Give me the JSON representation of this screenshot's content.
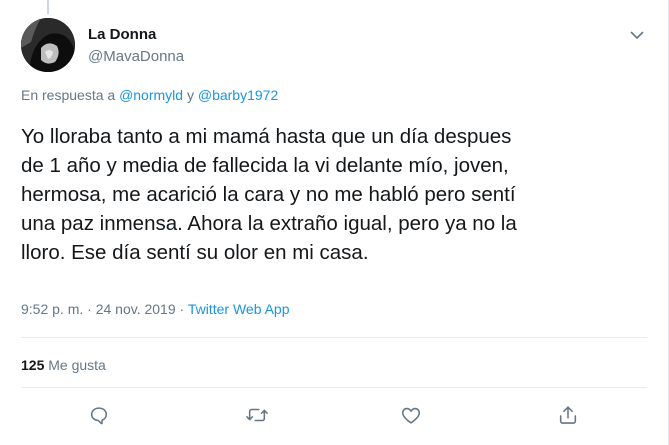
{
  "author": {
    "display_name": "La Donna",
    "handle": "@MavaDonna"
  },
  "reply": {
    "prefix": "En respuesta a",
    "mention1": "@normyld",
    "joiner": "y",
    "mention2": "@barby1972"
  },
  "tweet": {
    "lines": [
      "Yo lloraba tanto a mi mamá hasta que un día despues",
      "de 1 año y media de fallecida la vi delante mío, joven,",
      "hermosa, me acarició la cara y no me habló pero sentí",
      "una paz inmensa. Ahora la extraño igual, pero ya no la",
      "lloro. Ese día sentí su olor en mi casa."
    ]
  },
  "meta": {
    "timestamp": "9:52 p. m. · 24 nov. 2019",
    "separator": "·",
    "source": "Twitter Web App"
  },
  "stats": {
    "likes_count": "125",
    "likes_label": "Me gusta"
  },
  "icons": {
    "caret": "chevron-down-icon",
    "reply": "reply-icon",
    "retweet": "retweet-icon",
    "like": "heart-icon",
    "share": "share-icon"
  },
  "colors": {
    "link": "#1b95e0",
    "secondary_text": "#657786",
    "primary_text": "#14171a",
    "divider": "#e6ecf0"
  }
}
